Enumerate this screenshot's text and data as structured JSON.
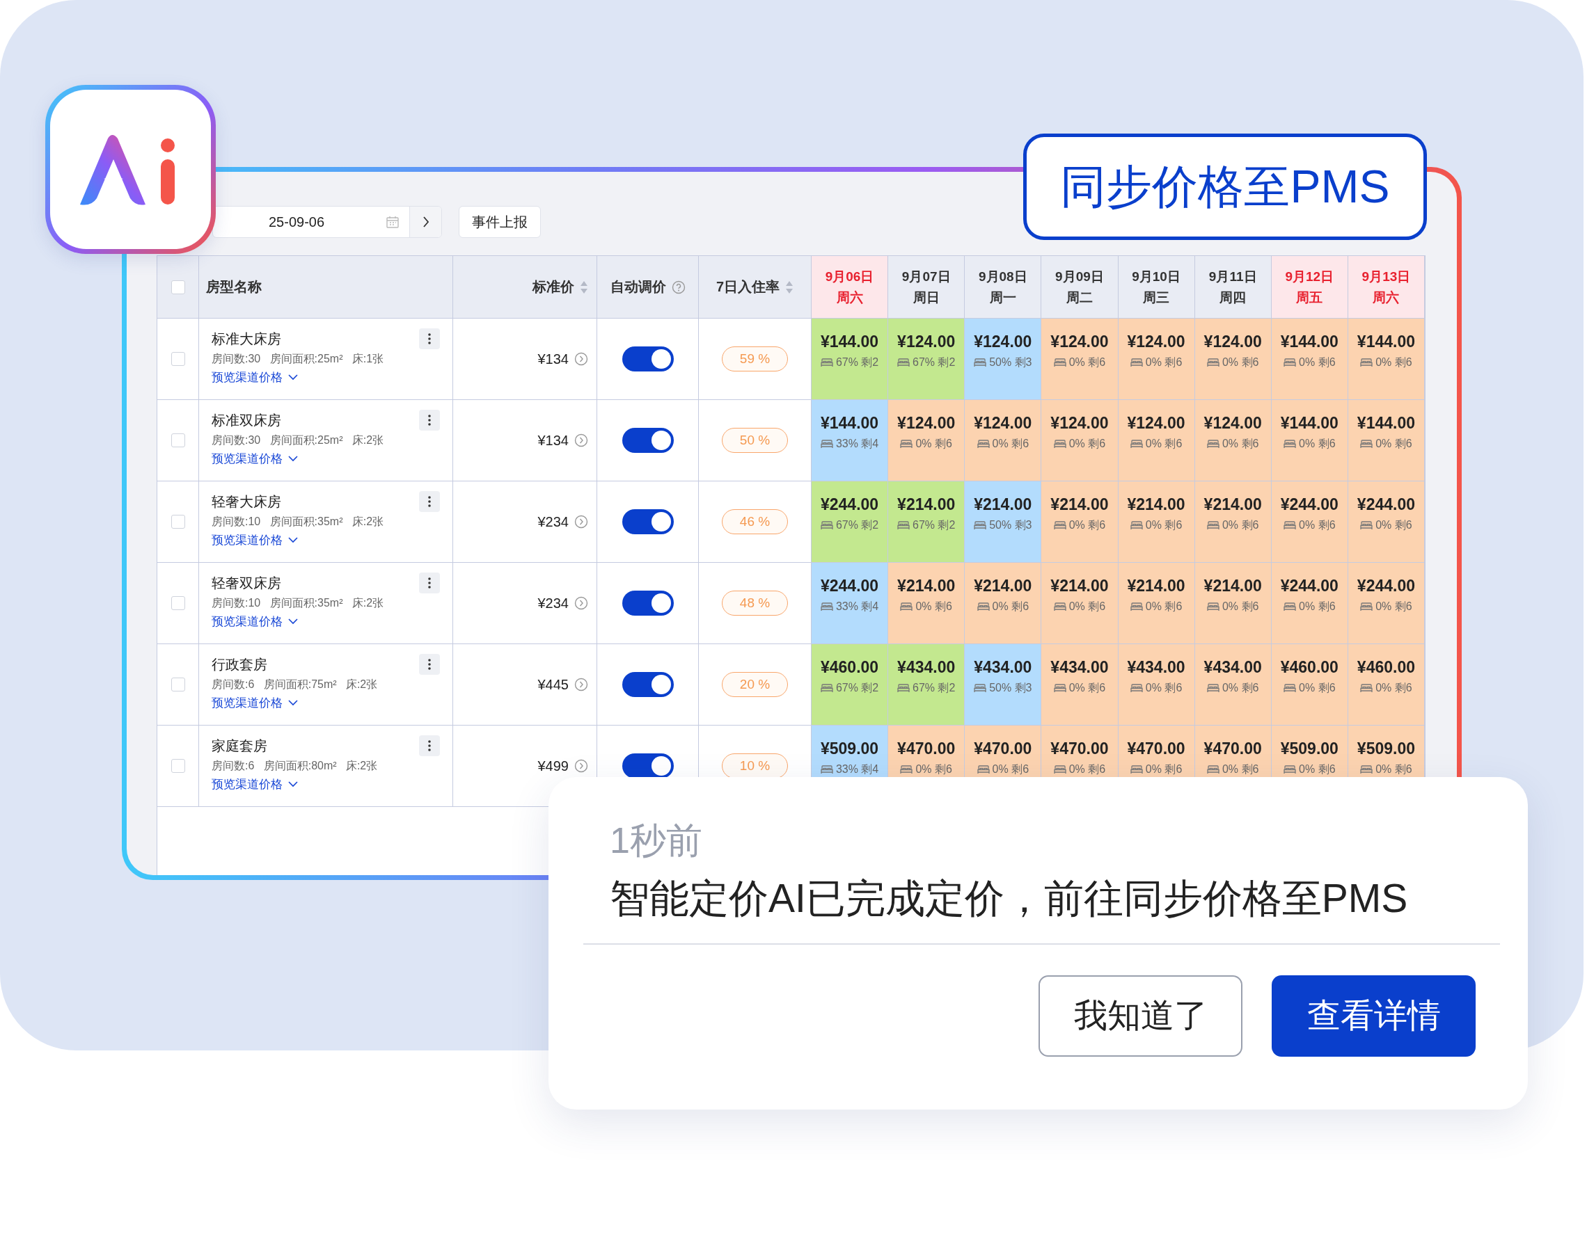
{
  "badge": "同步价格至PMS",
  "toolbar": {
    "date": "25-09-06",
    "report_button": "事件上报"
  },
  "table": {
    "select_all_checked": false,
    "columns": [
      {
        "label": "房型名称",
        "kind": "plain"
      },
      {
        "label": "标准价",
        "kind": "sortable"
      },
      {
        "label": "自动调价",
        "kind": "help"
      },
      {
        "label": "7日入住率",
        "kind": "sortable"
      }
    ],
    "dates": [
      {
        "date": "9月06日",
        "weekday": "周六",
        "highlighted": true
      },
      {
        "date": "9月07日",
        "weekday": "周日",
        "highlighted": false
      },
      {
        "date": "9月08日",
        "weekday": "周一",
        "highlighted": false
      },
      {
        "date": "9月09日",
        "weekday": "周二",
        "highlighted": false
      },
      {
        "date": "9月10日",
        "weekday": "周三",
        "highlighted": false
      },
      {
        "date": "9月11日",
        "weekday": "周四",
        "highlighted": false
      },
      {
        "date": "9月12日",
        "weekday": "周五",
        "highlighted": true
      },
      {
        "date": "9月13日",
        "weekday": "周六",
        "highlighted": true
      }
    ],
    "rows": [
      {
        "checked": false,
        "name": "标准大床房",
        "details": "房间数:30   房间面积:25m²   床:1张",
        "link": "预览渠道价格",
        "price": "¥134",
        "auto_pricing_on": true,
        "occupancy": "59 %",
        "cells": [
          {
            "price": "¥144.00",
            "stats": "67% 剩2",
            "color": "#c3e88f"
          },
          {
            "price": "¥124.00",
            "stats": "67% 剩2",
            "color": "#c3e88f"
          },
          {
            "price": "¥124.00",
            "stats": "50% 剩3",
            "color": "#b3dcfd"
          },
          {
            "price": "¥124.00",
            "stats": "0% 剩6",
            "color": "#fcd3b0"
          },
          {
            "price": "¥124.00",
            "stats": "0% 剩6",
            "color": "#fcd3b0"
          },
          {
            "price": "¥124.00",
            "stats": "0% 剩6",
            "color": "#fcd3b0"
          },
          {
            "price": "¥144.00",
            "stats": "0% 剩6",
            "color": "#fcd3b0"
          },
          {
            "price": "¥144.00",
            "stats": "0% 剩6",
            "color": "#fcd3b0"
          }
        ]
      },
      {
        "checked": false,
        "name": "标准双床房",
        "details": "房间数:30   房间面积:25m²   床:2张",
        "link": "预览渠道价格",
        "price": "¥134",
        "auto_pricing_on": true,
        "occupancy": "50 %",
        "cells": [
          {
            "price": "¥144.00",
            "stats": "33% 剩4",
            "color": "#b3dcfd"
          },
          {
            "price": "¥124.00",
            "stats": "0% 剩6",
            "color": "#fcd3b0"
          },
          {
            "price": "¥124.00",
            "stats": "0% 剩6",
            "color": "#fcd3b0"
          },
          {
            "price": "¥124.00",
            "stats": "0% 剩6",
            "color": "#fcd3b0"
          },
          {
            "price": "¥124.00",
            "stats": "0% 剩6",
            "color": "#fcd3b0"
          },
          {
            "price": "¥124.00",
            "stats": "0% 剩6",
            "color": "#fcd3b0"
          },
          {
            "price": "¥144.00",
            "stats": "0% 剩6",
            "color": "#fcd3b0"
          },
          {
            "price": "¥144.00",
            "stats": "0% 剩6",
            "color": "#fcd3b0"
          }
        ]
      },
      {
        "checked": false,
        "name": "轻奢大床房",
        "details": "房间数:10   房间面积:35m²   床:2张",
        "link": "预览渠道价格",
        "price": "¥234",
        "auto_pricing_on": true,
        "occupancy": "46 %",
        "cells": [
          {
            "price": "¥244.00",
            "stats": "67% 剩2",
            "color": "#c3e88f"
          },
          {
            "price": "¥214.00",
            "stats": "67% 剩2",
            "color": "#c3e88f"
          },
          {
            "price": "¥214.00",
            "stats": "50% 剩3",
            "color": "#b3dcfd"
          },
          {
            "price": "¥214.00",
            "stats": "0% 剩6",
            "color": "#fcd3b0"
          },
          {
            "price": "¥214.00",
            "stats": "0% 剩6",
            "color": "#fcd3b0"
          },
          {
            "price": "¥214.00",
            "stats": "0% 剩6",
            "color": "#fcd3b0"
          },
          {
            "price": "¥244.00",
            "stats": "0% 剩6",
            "color": "#fcd3b0"
          },
          {
            "price": "¥244.00",
            "stats": "0% 剩6",
            "color": "#fcd3b0"
          }
        ]
      },
      {
        "checked": false,
        "name": "轻奢双床房",
        "details": "房间数:10   房间面积:35m²   床:2张",
        "link": "预览渠道价格",
        "price": "¥234",
        "auto_pricing_on": true,
        "occupancy": "48 %",
        "cells": [
          {
            "price": "¥244.00",
            "stats": "33% 剩4",
            "color": "#b3dcfd"
          },
          {
            "price": "¥214.00",
            "stats": "0% 剩6",
            "color": "#fcd3b0"
          },
          {
            "price": "¥214.00",
            "stats": "0% 剩6",
            "color": "#fcd3b0"
          },
          {
            "price": "¥214.00",
            "stats": "0% 剩6",
            "color": "#fcd3b0"
          },
          {
            "price": "¥214.00",
            "stats": "0% 剩6",
            "color": "#fcd3b0"
          },
          {
            "price": "¥214.00",
            "stats": "0% 剩6",
            "color": "#fcd3b0"
          },
          {
            "price": "¥244.00",
            "stats": "0% 剩6",
            "color": "#fcd3b0"
          },
          {
            "price": "¥244.00",
            "stats": "0% 剩6",
            "color": "#fcd3b0"
          }
        ]
      },
      {
        "checked": false,
        "name": "行政套房",
        "details": "房间数:6   房间面积:75m²   床:2张",
        "link": "预览渠道价格",
        "price": "¥445",
        "auto_pricing_on": true,
        "occupancy": "20 %",
        "cells": [
          {
            "price": "¥460.00",
            "stats": "67% 剩2",
            "color": "#c3e88f"
          },
          {
            "price": "¥434.00",
            "stats": "67% 剩2",
            "color": "#c3e88f"
          },
          {
            "price": "¥434.00",
            "stats": "50% 剩3",
            "color": "#b3dcfd"
          },
          {
            "price": "¥434.00",
            "stats": "0% 剩6",
            "color": "#fcd3b0"
          },
          {
            "price": "¥434.00",
            "stats": "0% 剩6",
            "color": "#fcd3b0"
          },
          {
            "price": "¥434.00",
            "stats": "0% 剩6",
            "color": "#fcd3b0"
          },
          {
            "price": "¥460.00",
            "stats": "0% 剩6",
            "color": "#fcd3b0"
          },
          {
            "price": "¥460.00",
            "stats": "0% 剩6",
            "color": "#fcd3b0"
          }
        ]
      },
      {
        "checked": false,
        "name": "家庭套房",
        "details": "房间数:6   房间面积:80m²   床:2张",
        "link": "预览渠道价格",
        "price": "¥499",
        "auto_pricing_on": true,
        "occupancy": "10 %",
        "cells": [
          {
            "price": "¥509.00",
            "stats": "33% 剩4",
            "color": "#b3dcfd"
          },
          {
            "price": "¥470.00",
            "stats": "0% 剩6",
            "color": "#fcd3b0"
          },
          {
            "price": "¥470.00",
            "stats": "0% 剩6",
            "color": "#fcd3b0"
          },
          {
            "price": "¥470.00",
            "stats": "0% 剩6",
            "color": "#fcd3b0"
          },
          {
            "price": "¥470.00",
            "stats": "0% 剩6",
            "color": "#fcd3b0"
          },
          {
            "price": "¥470.00",
            "stats": "0% 剩6",
            "color": "#fcd3b0"
          },
          {
            "price": "¥509.00",
            "stats": "0% 剩6",
            "color": "#fcd3b0"
          },
          {
            "price": "¥509.00",
            "stats": "0% 剩6",
            "color": "#fcd3b0"
          }
        ]
      }
    ]
  },
  "notification": {
    "time": "1秒前",
    "message": "智能定价AI已完成定价，前往同步价格至PMS",
    "buttons": [
      {
        "label": "我知道了",
        "primary": false
      },
      {
        "label": "查看详情",
        "primary": true
      }
    ]
  }
}
